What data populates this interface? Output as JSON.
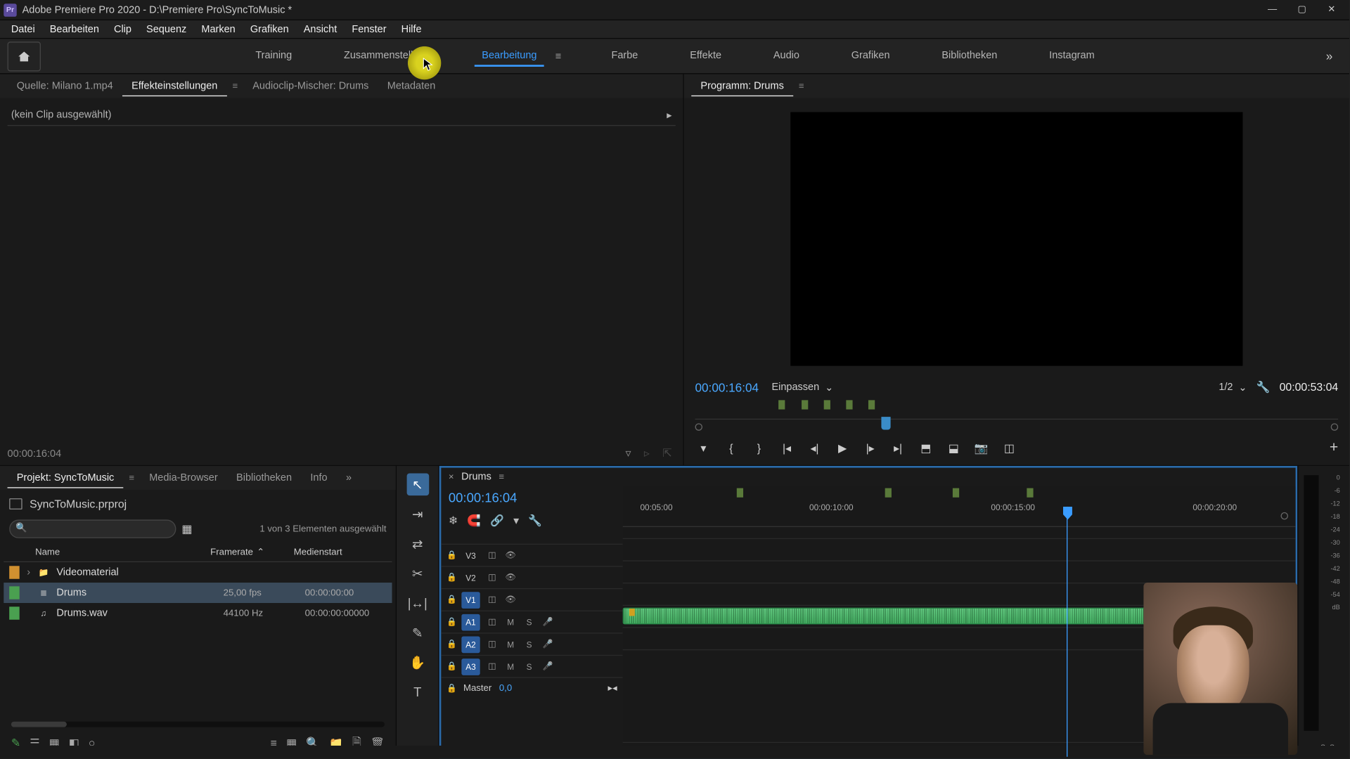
{
  "titlebar": {
    "app_icon": "Pr",
    "text": "Adobe Premiere Pro 2020 - D:\\Premiere Pro\\SyncToMusic *"
  },
  "menu": {
    "items": [
      "Datei",
      "Bearbeiten",
      "Clip",
      "Sequenz",
      "Marken",
      "Grafiken",
      "Ansicht",
      "Fenster",
      "Hilfe"
    ]
  },
  "workspaces": {
    "tabs": [
      "Training",
      "Zusammenstellung",
      "Bearbeitung",
      "Farbe",
      "Effekte",
      "Audio",
      "Grafiken",
      "Bibliotheken",
      "Instagram"
    ],
    "active_index": 2,
    "more": "»"
  },
  "source": {
    "tabs": [
      {
        "label": "Quelle: Milano 1.mp4"
      },
      {
        "label": "Effekteinstellungen"
      },
      {
        "label": "Audioclip-Mischer: Drums"
      },
      {
        "label": "Metadaten"
      }
    ],
    "active_tab": 1,
    "no_clip": "(kein Clip ausgewählt)",
    "timecode": "00:00:16:04"
  },
  "program": {
    "title": "Programm: Drums",
    "timecode_left": "00:00:16:04",
    "fit": "Einpassen",
    "res": "1/2",
    "timecode_right": "00:00:53:04"
  },
  "project": {
    "tabs": [
      {
        "label": "Projekt: SyncToMusic"
      },
      {
        "label": "Media-Browser"
      },
      {
        "label": "Bibliotheken"
      },
      {
        "label": "Info"
      }
    ],
    "active_tab": 0,
    "more": "»",
    "filename": "SyncToMusic.prproj",
    "count": "1 von 3 Elementen ausgewählt",
    "header": {
      "name": "Name",
      "framerate": "Framerate",
      "mediastart": "Medienstart"
    },
    "rows": [
      {
        "color": "or",
        "expand": "›",
        "icon": "bin",
        "name": "Videomaterial",
        "fr": "",
        "ms": ""
      },
      {
        "color": "gr",
        "expand": "",
        "icon": "seq",
        "name": "Drums",
        "fr": "25,00 fps",
        "ms": "00:00:00:00",
        "sel": true
      },
      {
        "color": "gr",
        "expand": "",
        "icon": "aud",
        "name": "Drums.wav",
        "fr": "44100 Hz",
        "ms": "00:00:00:00000"
      }
    ]
  },
  "timeline": {
    "name": "Drums",
    "timecode": "00:00:16:04",
    "ruler": [
      "00:05:00",
      "00:00:10:00",
      "00:00:15:00",
      "00:00:20:00"
    ],
    "video_tracks": [
      {
        "label": "V3"
      },
      {
        "label": "V2"
      },
      {
        "label": "V1",
        "active": true
      }
    ],
    "audio_tracks": [
      {
        "label": "A1",
        "active": true
      },
      {
        "label": "A2",
        "active": true
      },
      {
        "label": "A3",
        "active": true
      }
    ],
    "master": {
      "label": "Master",
      "value": "0,0"
    }
  },
  "meters": {
    "scale": [
      "0",
      "-6",
      "-12",
      "-18",
      "-24",
      "-30",
      "-36",
      "-42",
      "-48",
      "-54",
      "dB"
    ],
    "s_left": "S",
    "s_right": "S"
  }
}
